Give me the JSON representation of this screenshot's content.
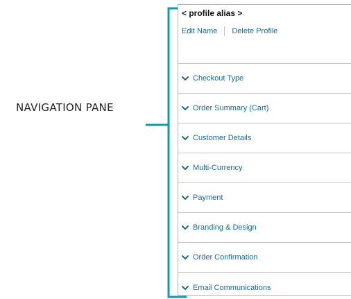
{
  "annotation": {
    "label": "NAVIGATION PANE",
    "accent_color": "#0e9aa7"
  },
  "profile": {
    "alias": "< profile alias >",
    "edit_label": "Edit Name",
    "delete_label": "Delete Profile"
  },
  "nav": {
    "icon": "chevron-down-icon",
    "link_color": "#1a6a8a",
    "items": [
      {
        "label": "Checkout Type"
      },
      {
        "label": "Order Summary (Cart)"
      },
      {
        "label": "Customer Details"
      },
      {
        "label": "Multi-Currency"
      },
      {
        "label": "Payment"
      },
      {
        "label": "Branding & Design"
      },
      {
        "label": "Order Confirmation"
      },
      {
        "label": "Email Communications"
      }
    ]
  }
}
